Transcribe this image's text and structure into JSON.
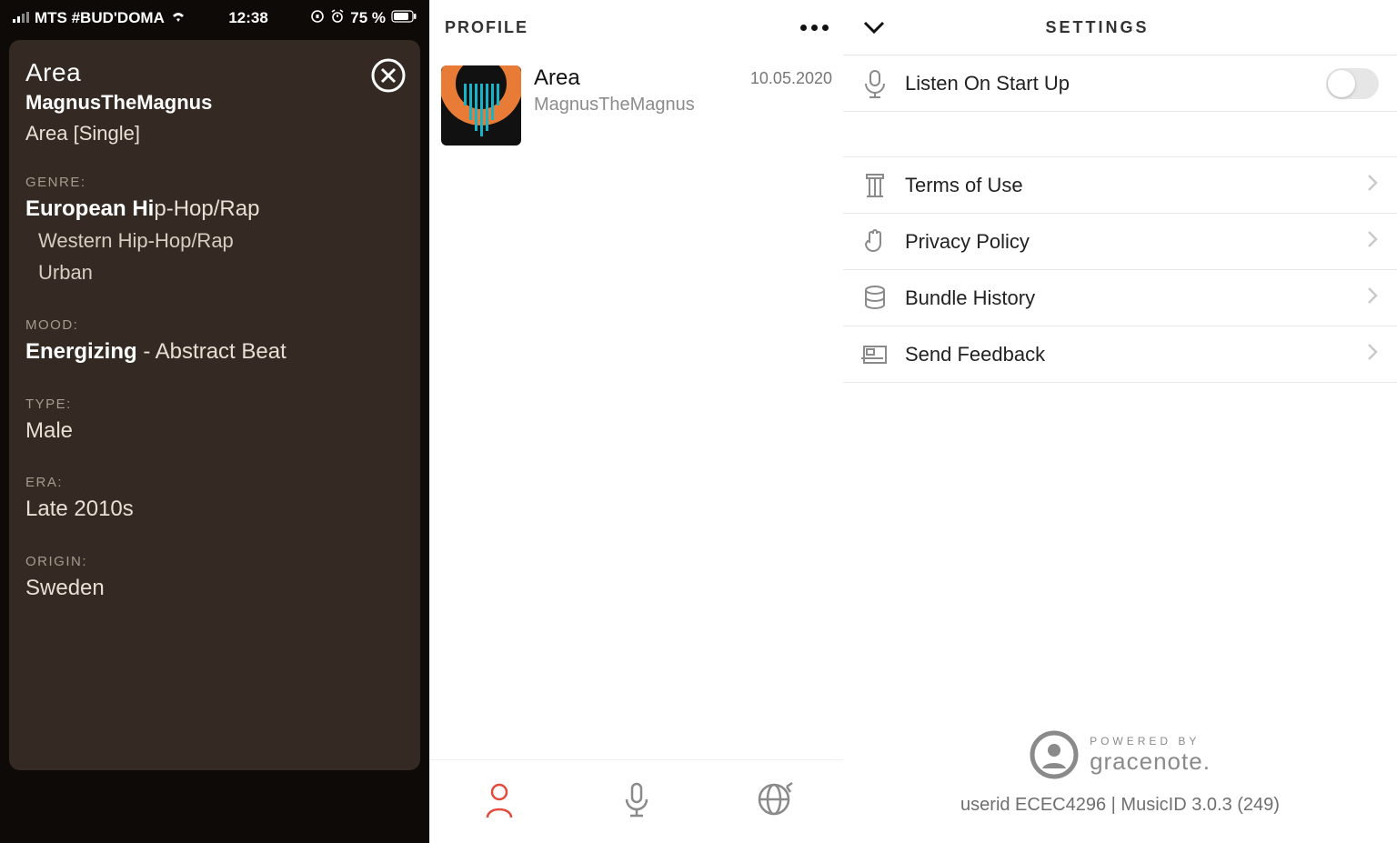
{
  "statusbar": {
    "carrier": "MTS #BUD'DOMA",
    "time": "12:38",
    "battery": "75 %"
  },
  "detail": {
    "track": "Area",
    "artist": "MagnusTheMagnus",
    "album": "Area [Single]",
    "genre_label": "GENRE:",
    "genre_main_bold": "European Hi",
    "genre_main_rest": "p-Hop/Rap",
    "genre_sub1": "Western Hip-Hop/Rap",
    "genre_sub2": "Urban",
    "mood_label": "MOOD:",
    "mood_bold": "Energizing",
    "mood_rest": " - Abstract Beat",
    "type_label": "TYPE:",
    "type_value": "Male",
    "era_label": "ERA:",
    "era_value": "Late 2010s",
    "origin_label": "ORIGIN:",
    "origin_value": "Sweden"
  },
  "profile": {
    "header": "PROFILE",
    "row": {
      "title": "Area",
      "subtitle": "MagnusTheMagnus",
      "date": "10.05.2020"
    }
  },
  "settings": {
    "header": "SETTINGS",
    "listen_startup": "Listen On Start Up",
    "terms": "Terms of Use",
    "privacy": "Privacy Policy",
    "bundle": "Bundle History",
    "feedback": "Send Feedback"
  },
  "gracenote": {
    "small": "POWERED BY",
    "big": "gracenote."
  },
  "footer": "userid ECEC4296 | MusicID 3.0.3 (249)"
}
